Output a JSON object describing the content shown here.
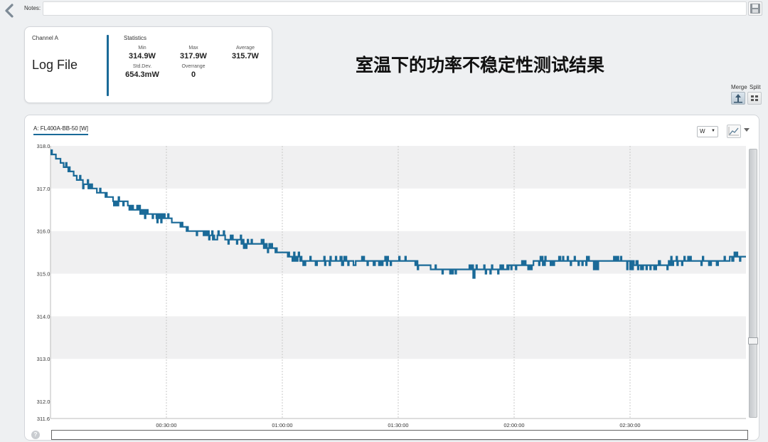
{
  "topbar": {
    "notes_label": "Notes:",
    "notes_value": ""
  },
  "stats_card": {
    "channel": "Channel A",
    "source": "Log File",
    "title": "Statistics",
    "min_label": "Min",
    "min_value": "314.9W",
    "max_label": "Max",
    "max_value": "317.9W",
    "avg_label": "Average",
    "avg_value": "315.7W",
    "std_label": "Std.Dev.",
    "std_value": "654.3mW",
    "over_label": "Overrange",
    "over_value": "0"
  },
  "heading": "室温下的功率不稳定性测试结果",
  "view_controls": {
    "merge_label": "Merge",
    "split_label": "Split"
  },
  "chart_panel": {
    "series_tab": "A: FL400A-BB-50 [W]",
    "unit": "W",
    "help": "?"
  },
  "colors": {
    "series": "#1a6a98",
    "band": "#f0f0f1"
  },
  "chart_data": {
    "type": "line",
    "ylim": [
      311.6,
      318.0
    ],
    "y_ticks": [
      "318.0",
      "317.0",
      "316.0",
      "315.0",
      "314.0",
      "313.0",
      "312.0",
      "311.6"
    ],
    "x_ticks": [
      "00:30:00",
      "01:00:00",
      "01:30:00",
      "02:00:00",
      "02:30:00"
    ],
    "x_tick_minutes": [
      30,
      60,
      90,
      120,
      150
    ],
    "xlim_minutes": [
      0,
      180
    ],
    "grid": true,
    "series": [
      {
        "x_minutes": [
          0,
          3,
          6,
          9,
          12,
          16,
          20,
          25,
          30,
          35,
          40,
          45,
          50,
          55,
          60,
          63,
          66,
          70,
          75,
          80,
          85,
          90,
          95,
          100,
          105,
          110,
          115,
          120,
          125,
          130,
          135,
          140,
          145,
          150,
          155,
          160,
          165,
          170,
          175,
          180
        ],
        "values": [
          317.85,
          317.6,
          317.3,
          317.1,
          316.95,
          316.75,
          316.6,
          316.4,
          316.3,
          316.05,
          315.95,
          315.85,
          315.75,
          315.65,
          315.5,
          315.38,
          315.32,
          315.3,
          315.3,
          315.3,
          315.3,
          315.3,
          315.25,
          315.1,
          315.05,
          315.05,
          315.1,
          315.18,
          315.25,
          315.28,
          315.28,
          315.25,
          315.25,
          315.25,
          315.2,
          315.25,
          315.3,
          315.32,
          315.35,
          315.35
        ]
      }
    ]
  }
}
